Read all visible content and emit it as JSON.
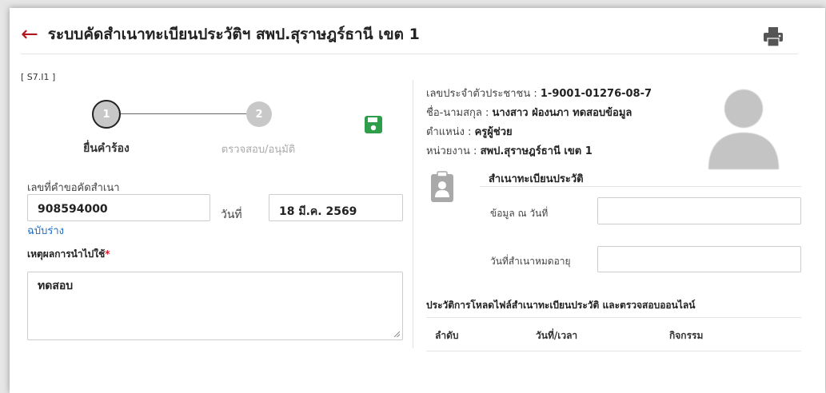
{
  "header": {
    "title": "ระบบคัดสำเนาทะเบียนประวัติฯ สพป.สุราษฎร์ธานี เขต 1",
    "code": "[ S7.I1 ]"
  },
  "stepper": {
    "steps": [
      {
        "number": "1",
        "label": "ยื่นคำร้อง"
      },
      {
        "number": "2",
        "label": "ตรวจสอบ/อนุมัติ"
      }
    ]
  },
  "form": {
    "request_no_label": "เลขที่คำขอคัดสำเนา",
    "request_no_value": "908594000",
    "date_label": "วันที่",
    "date_value": "18 มี.ค. 2569",
    "draft_link": "ฉบับร่าง",
    "reason_label": "เหตุผลการนำไปใช้",
    "reason_required": "*",
    "reason_value": "ทดสอบ"
  },
  "person": {
    "id_label": "เลขประจำตัวประชาชน : ",
    "id_value": "1-9001-01276-08-7",
    "name_label": "ชื่อ-นามสกุล : ",
    "name_value": "นางสาว ฝ่องนภา ทดสอบข้อมูล",
    "position_label": "ตำแหน่ง : ",
    "position_value": "ครูผู้ช่วย",
    "unit_label": "หน่วยงาน : ",
    "unit_value": "สพป.สุราษฎร์ธานี เขต 1"
  },
  "record": {
    "title": "สำเนาทะเบียนประวัติ",
    "data_as_of_label": "ข้อมูล ณ วันที่",
    "expiry_label": "วันที่สำเนาหมดอายุ"
  },
  "history": {
    "title": "ประวัติการโหลดไฟล์สำเนาทะเบียนประวัติ และตรวจสอบออนไลน์",
    "columns": [
      "ลำดับ",
      "วันที่/เวลา",
      "กิจกรรม"
    ]
  },
  "icons": {
    "back": "arrow-left-icon",
    "print": "printer-icon",
    "save": "floppy-disk-icon",
    "record": "clipboard-user-icon",
    "avatar": "user-silhouette-icon"
  },
  "colors": {
    "back_arrow": "#b0171f",
    "save_icon": "#2e9e4a",
    "link": "#1e6fc9",
    "required": "#e0192f"
  }
}
